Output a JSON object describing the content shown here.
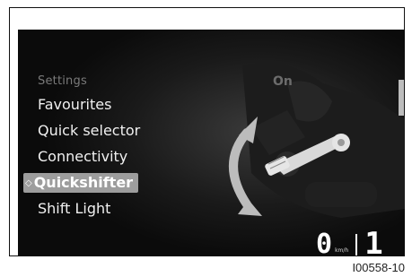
{
  "menu": {
    "title": "Settings",
    "items": [
      {
        "label": "Favourites",
        "selected": false
      },
      {
        "label": "Quick selector",
        "selected": false
      },
      {
        "label": "Connectivity",
        "selected": false
      },
      {
        "label": "Quickshifter",
        "selected": true
      },
      {
        "label": "Shift Light",
        "selected": false
      }
    ]
  },
  "status": {
    "value": "On"
  },
  "dash": {
    "speed": "0",
    "speed_unit": "km/h",
    "gear": "1"
  },
  "figure": {
    "caption": "I00558-10"
  },
  "colors": {
    "screen_bg": "#0b0b0b",
    "selected_bg": "#9d9d9d",
    "text": "#f0f0f0",
    "muted_text": "#7a7a7a"
  },
  "icons": [
    "shift-direction-arrows-icon",
    "gear-shift-lever-icon"
  ]
}
